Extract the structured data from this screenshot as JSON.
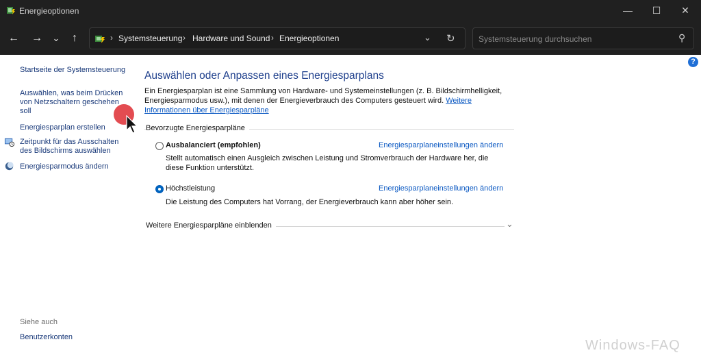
{
  "window": {
    "title": "Energieoptionen",
    "controls": {
      "minimize": "—",
      "maximize": "☐",
      "close": "✕"
    }
  },
  "nav": {
    "back": "←",
    "forward": "→",
    "recent": "⌄",
    "up": "↑",
    "breadcrumb": [
      "Systemsteuerung",
      "Hardware und Sound",
      "Energieoptionen"
    ],
    "separator": "›",
    "dropdown": "⌄",
    "refresh": "↻",
    "search_placeholder": "Systemsteuerung durchsuchen",
    "search_icon": "⚲"
  },
  "sidebar": {
    "links": [
      {
        "label": "Startseite der Systemsteuerung",
        "icon": ""
      },
      {
        "label": "Auswählen, was beim Drücken von Netzschaltern geschehen soll",
        "icon": ""
      },
      {
        "label": "Energiesparplan erstellen",
        "icon": ""
      },
      {
        "label": "Zeitpunkt für das Ausschalten des Bildschirms auswählen",
        "icon": "monitor-clock-icon"
      },
      {
        "label": "Energiesparmodus ändern",
        "icon": "moon-icon"
      }
    ],
    "see_also_title": "Siehe auch",
    "see_also_links": [
      "Benutzerkonten"
    ]
  },
  "main": {
    "heading": "Auswählen oder Anpassen eines Energiesparplans",
    "description_line1": "Ein Energiesparplan ist eine Sammlung von Hardware- und Systemeinstellungen (z. B. Bildschirmhelligkeit,",
    "description_line2": "Energiesparmodus usw.), mit denen der Energieverbrauch des Computers gesteuert wird.",
    "more_info_link_part1": "Weitere",
    "more_info_link_part2": "Informationen über Energiesparpläne",
    "group_title": "Bevorzugte Energiesparpläne",
    "plans": [
      {
        "name": "Ausbalanciert (empfohlen)",
        "selected": false,
        "description_line1": "Stellt automatisch einen Ausgleich zwischen Leistung und Stromverbrauch der Hardware her, die",
        "description_line2": "diese Funktion unterstützt.",
        "link": "Energiesparplaneinstellungen ändern"
      },
      {
        "name": "Höchstleistung",
        "selected": true,
        "description_line1": "Die Leistung des Computers hat Vorrang, der Energieverbrauch kann aber höher sein.",
        "description_line2": "",
        "link": "Energiesparplaneinstellungen ändern"
      }
    ],
    "show_more_label": "Weitere Energiesparpläne einblenden",
    "show_more_chevron": "⌄",
    "help_icon": "?"
  },
  "watermark": "Windows-FAQ",
  "colors": {
    "accent": "#0067c0",
    "heading": "#1e3f8c",
    "link": "#0a58c2",
    "titlebar": "#202020"
  }
}
